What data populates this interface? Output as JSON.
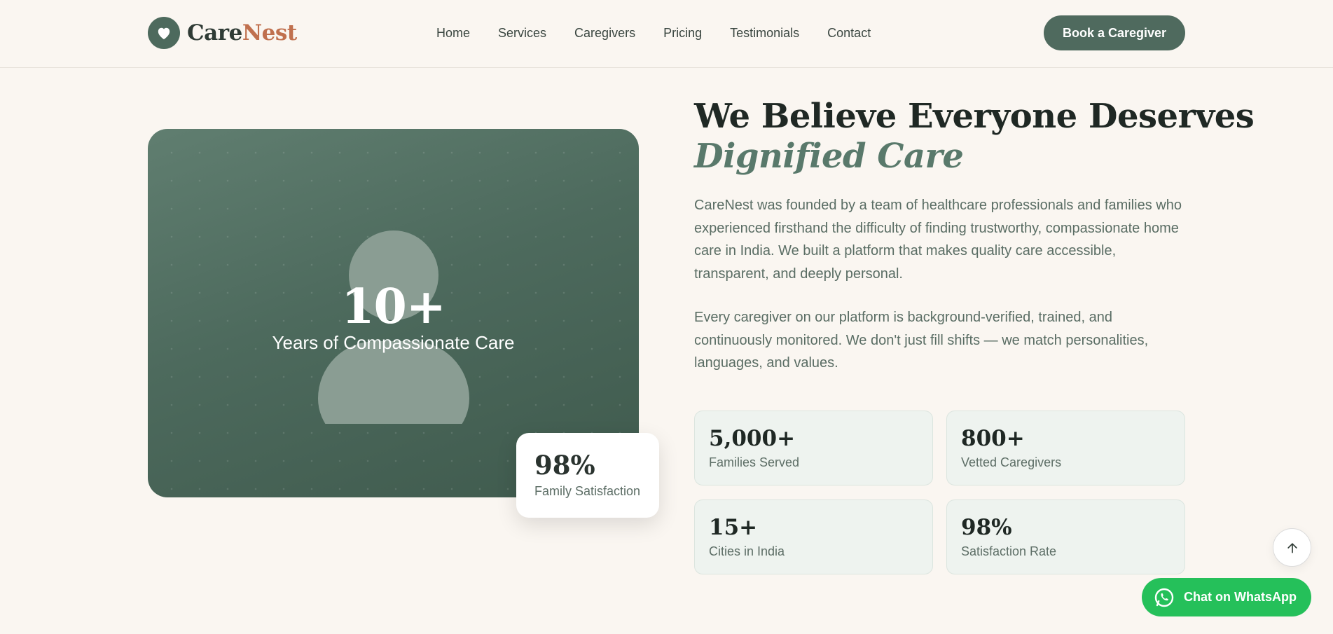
{
  "header": {
    "logo": {
      "brand_first": "Care",
      "brand_second": "Nest",
      "icon": "heart-icon"
    },
    "nav": [
      "Home",
      "Services",
      "Caregivers",
      "Pricing",
      "Testimonials",
      "Contact"
    ],
    "cta_label": "Book a Caregiver"
  },
  "hero_card": {
    "years_value": "10+",
    "years_label": "Years of Compassionate Care",
    "floating": {
      "value": "98%",
      "label": "Family Satisfaction"
    }
  },
  "about": {
    "headline": "We Believe Everyone Deserves",
    "headline_accent": "Dignified Care",
    "paragraph_1": "CareNest was founded by a team of healthcare professionals and families who experienced firsthand the difficulty of finding trustworthy, compassionate home care in India. We built a platform that makes quality care accessible, transparent, and deeply personal.",
    "paragraph_2": "Every caregiver on our platform is background-verified, trained, and continuously monitored. We don't just fill shifts — we match personalities, languages, and values."
  },
  "stats": [
    {
      "value": "5,000+",
      "label": "Families Served"
    },
    {
      "value": "800+",
      "label": "Vetted Caregivers"
    },
    {
      "value": "15+",
      "label": "Cities in India"
    },
    {
      "value": "98%",
      "label": "Satisfaction Rate"
    }
  ],
  "floating_actions": {
    "scroll_top_icon": "arrow-up-icon",
    "whatsapp_label": "Chat on WhatsApp",
    "whatsapp_icon": "whatsapp-icon"
  },
  "colors": {
    "background": "#faf6f1",
    "primary_green": "#4f6a5e",
    "accent_terracotta": "#c0704e",
    "whatsapp_green": "#25c05a"
  }
}
